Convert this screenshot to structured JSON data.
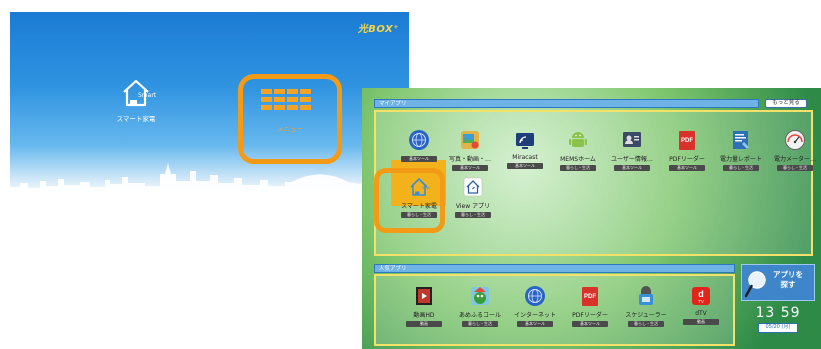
{
  "home": {
    "brand": "光BOX⁺",
    "smart_label": "スマート家電",
    "smart_icon_text": "Smart",
    "menu_label": "メニュー"
  },
  "app": {
    "my_apps_title": "マイアプリ",
    "more_button": "もっと見る",
    "my_apps": [
      {
        "name": "",
        "cat": "基本ツール",
        "icon": "globe-icon"
      },
      {
        "name": "写真・動画・…",
        "cat": "基本ツール",
        "icon": "photo-icon"
      },
      {
        "name": "Miracast",
        "cat": "基本ツール",
        "icon": "miracast-icon"
      },
      {
        "name": "MEMSホーム",
        "cat": "暮らし・生活",
        "icon": "android-icon"
      },
      {
        "name": "ユーザー情報…",
        "cat": "基本ツール",
        "icon": "user-info-icon"
      },
      {
        "name": "PDFリーダー",
        "cat": "基本ツール",
        "icon": "pdf-icon"
      },
      {
        "name": "電力量レポート",
        "cat": "暮らし・生活",
        "icon": "power-report-icon"
      },
      {
        "name": "電力メーター…",
        "cat": "暮らし・生活",
        "icon": "power-meter-icon"
      },
      {
        "name": "スマート家電",
        "cat": "暮らし・生活",
        "icon": "smart-home-icon"
      },
      {
        "name": "View アプリ",
        "cat": "暮らし・生活",
        "icon": "view-app-icon"
      }
    ],
    "popular_title": "人気アプリ",
    "popular_apps": [
      {
        "name": "動画HD",
        "cat": "動画",
        "icon": "video-hd-icon"
      },
      {
        "name": "あめふるコール",
        "cat": "暮らし・生活",
        "icon": "rain-call-icon"
      },
      {
        "name": "インターネット",
        "cat": "基本ツール",
        "icon": "internet-icon"
      },
      {
        "name": "PDFリーダー",
        "cat": "基本ツール",
        "icon": "pdf-icon"
      },
      {
        "name": "スケジューラー",
        "cat": "暮らし・生活",
        "icon": "scheduler-icon"
      },
      {
        "name": "dTV",
        "cat": "動画",
        "icon": "dtv-icon"
      }
    ],
    "search_label_1": "アプリを",
    "search_label_2": "探す",
    "time": "13 59",
    "date": "05/20 (月)"
  },
  "colors": {
    "accent_orange": "#f39a17",
    "panel_border": "#f2e26b",
    "bar_blue": "#6fb3e6"
  }
}
